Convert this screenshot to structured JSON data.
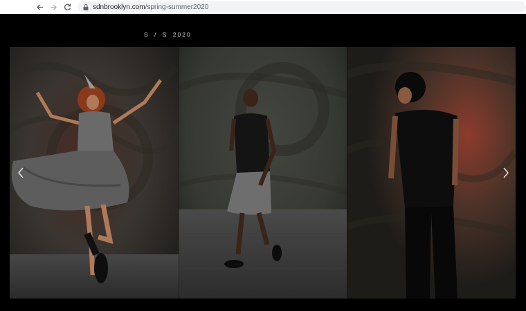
{
  "browser": {
    "url_domain": "sdnbrooklyn.com",
    "url_path": "/spring-summer2020",
    "back_icon": "arrow-left-icon",
    "forward_icon": "arrow-right-icon",
    "reload_icon": "reload-icon",
    "lock_icon": "lock-icon"
  },
  "page": {
    "season_label": "S / S  2020",
    "gallery": {
      "prev_icon": "chevron-left-icon",
      "next_icon": "chevron-right-icon",
      "slides": [
        "model-in-grey-dress",
        "model-in-grey-skirt",
        "model-in-black-outfit"
      ]
    }
  }
}
